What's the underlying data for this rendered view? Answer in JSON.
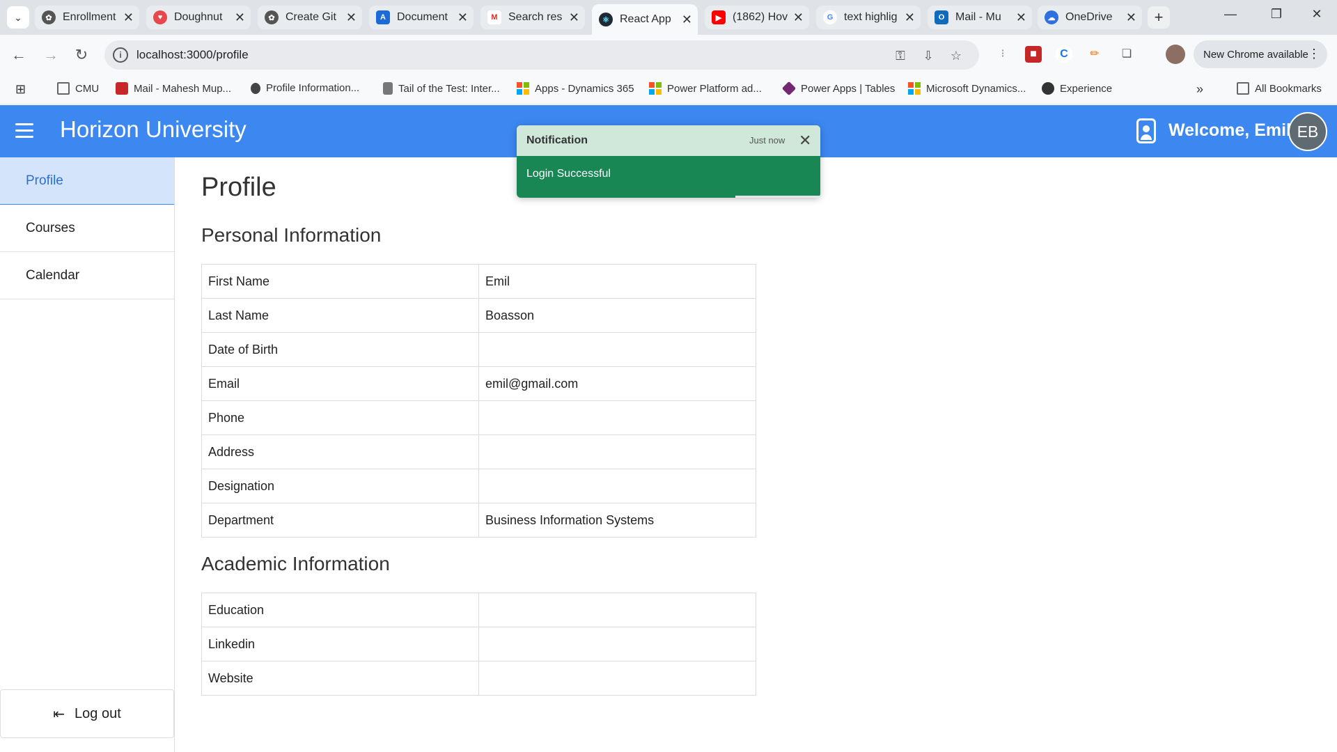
{
  "browser": {
    "tabs": [
      {
        "title": "Enrollment",
        "icon": "openai-icon",
        "color": "#555555",
        "active": false
      },
      {
        "title": "Doughnut",
        "icon": "heart-icon",
        "color": "#e5484d",
        "active": false
      },
      {
        "title": "Create Git",
        "icon": "openai-icon",
        "color": "#555555",
        "active": false
      },
      {
        "title": "Document",
        "icon": "a-logo-icon",
        "color": "#1a6bd8",
        "active": false
      },
      {
        "title": "Search res",
        "icon": "gmail-icon",
        "color": "#d93025",
        "active": false
      },
      {
        "title": "React App",
        "icon": "react-icon",
        "color": "#1f2a33",
        "active": true
      },
      {
        "title": "(1862) Hov",
        "icon": "youtube-icon",
        "color": "#ff0000",
        "active": false
      },
      {
        "title": "text highlig",
        "icon": "google-icon",
        "color": "#4285f4",
        "active": false
      },
      {
        "title": "Mail - Mu",
        "icon": "outlook-icon",
        "color": "#0f6cbd",
        "active": false
      },
      {
        "title": "OneDrive",
        "icon": "onedrive-icon",
        "color": "#2f6fdf",
        "active": false
      }
    ],
    "url": "localhost:3000/profile",
    "new_chrome_label": "New Chrome available",
    "bookmarks": [
      {
        "label": "CMU",
        "icon": "folder-icon"
      },
      {
        "label": "Mail - Mahesh Mup...",
        "icon": "mail-icon"
      },
      {
        "label": "Profile Information...",
        "icon": "apple-icon"
      },
      {
        "label": "Tail of the Test: Inter...",
        "icon": "runner-icon"
      },
      {
        "label": "Apps - Dynamics 365",
        "icon": "microsoft-icon"
      },
      {
        "label": "Power Platform ad...",
        "icon": "microsoft-icon"
      },
      {
        "label": "Power Apps | Tables",
        "icon": "powerapps-icon"
      },
      {
        "label": "Microsoft Dynamics...",
        "icon": "microsoft-icon"
      },
      {
        "label": "Experience",
        "icon": "globe-icon"
      }
    ],
    "all_bookmarks_label": "All Bookmarks"
  },
  "header": {
    "title": "Horizon University",
    "welcome": "Welcome, Emil",
    "avatar_initials": "EB",
    "color": "#3c87f0"
  },
  "sidebar": {
    "items": [
      {
        "label": "Profile",
        "active": true
      },
      {
        "label": "Courses",
        "active": false
      },
      {
        "label": "Calendar",
        "active": false
      }
    ],
    "logout_label": "Log out"
  },
  "main": {
    "title": "Profile",
    "personal": {
      "heading": "Personal Information",
      "rows": [
        {
          "label": "First Name",
          "value": "Emil"
        },
        {
          "label": "Last Name",
          "value": "Boasson"
        },
        {
          "label": "Date of Birth",
          "value": ""
        },
        {
          "label": "Email",
          "value": "emil@gmail.com"
        },
        {
          "label": "Phone",
          "value": ""
        },
        {
          "label": "Address",
          "value": ""
        },
        {
          "label": "Designation",
          "value": ""
        },
        {
          "label": "Department",
          "value": "Business Information Systems"
        }
      ]
    },
    "academic": {
      "heading": "Academic Information",
      "rows": [
        {
          "label": "Education",
          "value": ""
        },
        {
          "label": "Linkedin",
          "value": ""
        },
        {
          "label": "Website",
          "value": ""
        }
      ]
    }
  },
  "toast": {
    "title": "Notification",
    "time": "Just now",
    "message": "Login Successful",
    "progress": 0.72,
    "color": "#198754"
  }
}
